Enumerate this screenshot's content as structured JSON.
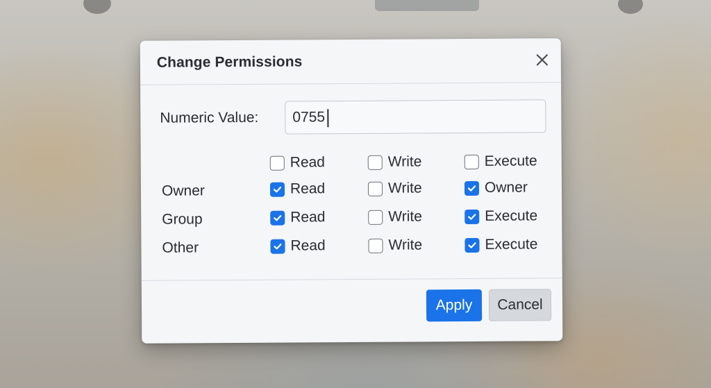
{
  "dialog": {
    "title": "Change Permissions",
    "close_icon": "close-icon"
  },
  "numeric": {
    "label": "Numeric Value:",
    "value": "0755"
  },
  "permissions": {
    "header_row": [
      {
        "label": "Read",
        "checked": false
      },
      {
        "label": "Write",
        "checked": false
      },
      {
        "label": "Execute",
        "checked": false
      }
    ],
    "rows": [
      {
        "label": "Owner",
        "items": [
          {
            "label": "Read",
            "checked": true
          },
          {
            "label": "Write",
            "checked": false
          },
          {
            "label": "Owner",
            "checked": true
          }
        ]
      },
      {
        "label": "Group",
        "items": [
          {
            "label": "Read",
            "checked": true
          },
          {
            "label": "Write",
            "checked": false
          },
          {
            "label": "Execute",
            "checked": true
          }
        ]
      },
      {
        "label": "Other",
        "items": [
          {
            "label": "Read",
            "checked": true
          },
          {
            "label": "Write",
            "checked": false
          },
          {
            "label": "Execute",
            "checked": true
          }
        ]
      }
    ]
  },
  "buttons": {
    "apply": "Apply",
    "cancel": "Cancel"
  },
  "colors": {
    "accent": "#1a73e8",
    "dialog_bg": "#f4f6f8",
    "text": "#2a2d31"
  }
}
